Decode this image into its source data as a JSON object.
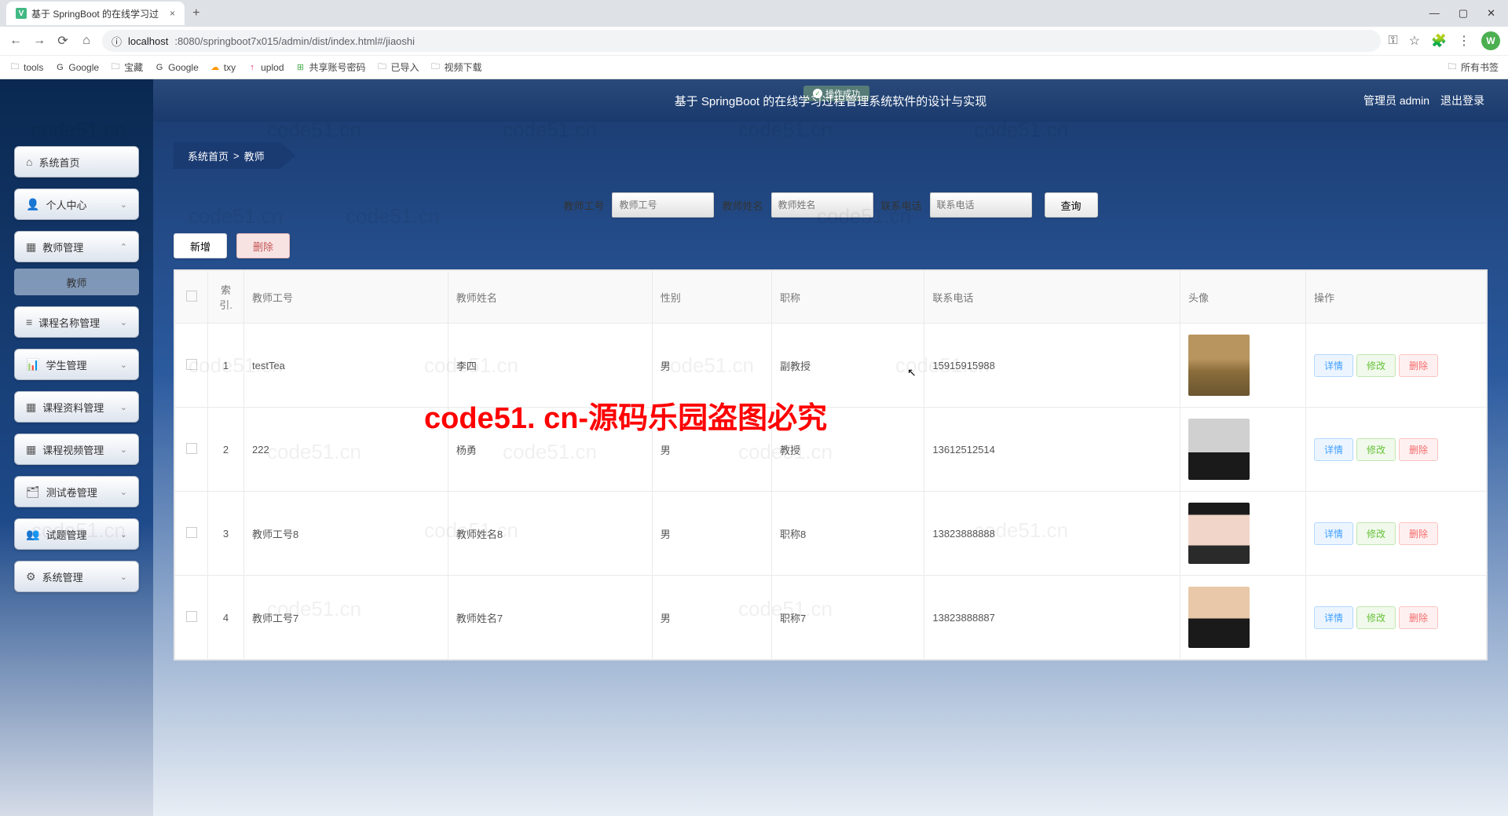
{
  "browser": {
    "tab_title": "基于 SpringBoot 的在线学习过",
    "url_host": "localhost",
    "url_port_path": ":8080/springboot7x015/admin/dist/index.html#/jiaoshi",
    "bookmarks": [
      "tools",
      "Google",
      "宝藏",
      "Google",
      "txy",
      "uplod",
      "共享账号密码",
      "已导入",
      "视频下载"
    ],
    "all_bookmarks": "所有书签"
  },
  "header": {
    "notify": "操作成功",
    "title": "基于 SpringBoot 的在线学习过程管理系统软件的设计与实现",
    "user_label": "管理员 admin",
    "logout": "退出登录"
  },
  "sidebar": {
    "items": [
      {
        "icon": "⌂",
        "label": "系统首页"
      },
      {
        "icon": "👤",
        "label": "个人中心",
        "arrow": "⌄"
      },
      {
        "icon": "▦",
        "label": "教师管理",
        "arrow": "⌃"
      },
      {
        "icon": "≡",
        "label": "课程名称管理",
        "arrow": "⌄"
      },
      {
        "icon": "📊",
        "label": "学生管理",
        "arrow": "⌄"
      },
      {
        "icon": "▦",
        "label": "课程资料管理",
        "arrow": "⌄"
      },
      {
        "icon": "▦",
        "label": "课程视频管理",
        "arrow": "⌄"
      },
      {
        "icon": "🗂",
        "label": "测试卷管理",
        "arrow": "⌄"
      },
      {
        "icon": "👥",
        "label": "试题管理",
        "arrow": "⌄"
      },
      {
        "icon": "⚙",
        "label": "系统管理",
        "arrow": "⌄"
      }
    ],
    "sub_item": "教师"
  },
  "breadcrumb": {
    "home": "系统首页",
    "sep": ">",
    "current": "教师"
  },
  "search": {
    "f1_label": "教师工号",
    "f1_ph": "教师工号",
    "f2_label": "教师姓名",
    "f2_ph": "教师姓名",
    "f3_label": "联系电话",
    "f3_ph": "联系电话",
    "query": "查询"
  },
  "actions": {
    "add": "新增",
    "delete": "删除"
  },
  "table": {
    "headers": {
      "idx": "索引.",
      "id": "教师工号",
      "name": "教师姓名",
      "gender": "性别",
      "title": "职称",
      "phone": "联系电话",
      "avatar": "头像",
      "ops": "操作"
    },
    "ops": {
      "detail": "详情",
      "edit": "修改",
      "delete": "删除"
    },
    "rows": [
      {
        "idx": "1",
        "id": "testTea",
        "name": "李四",
        "gender": "男",
        "title": "副教授",
        "phone": "15915915988",
        "av": "av1"
      },
      {
        "idx": "2",
        "id": "222",
        "name": "杨勇",
        "gender": "男",
        "title": "教授",
        "phone": "13612512514",
        "av": "av2"
      },
      {
        "idx": "3",
        "id": "教师工号8",
        "name": "教师姓名8",
        "gender": "男",
        "title": "职称8",
        "phone": "13823888888",
        "av": "av3"
      },
      {
        "idx": "4",
        "id": "教师工号7",
        "name": "教师姓名7",
        "gender": "男",
        "title": "职称7",
        "phone": "13823888887",
        "av": "av4"
      }
    ]
  },
  "watermark": "code51. cn-源码乐园盗图必究",
  "wm_small": "code51.cn"
}
